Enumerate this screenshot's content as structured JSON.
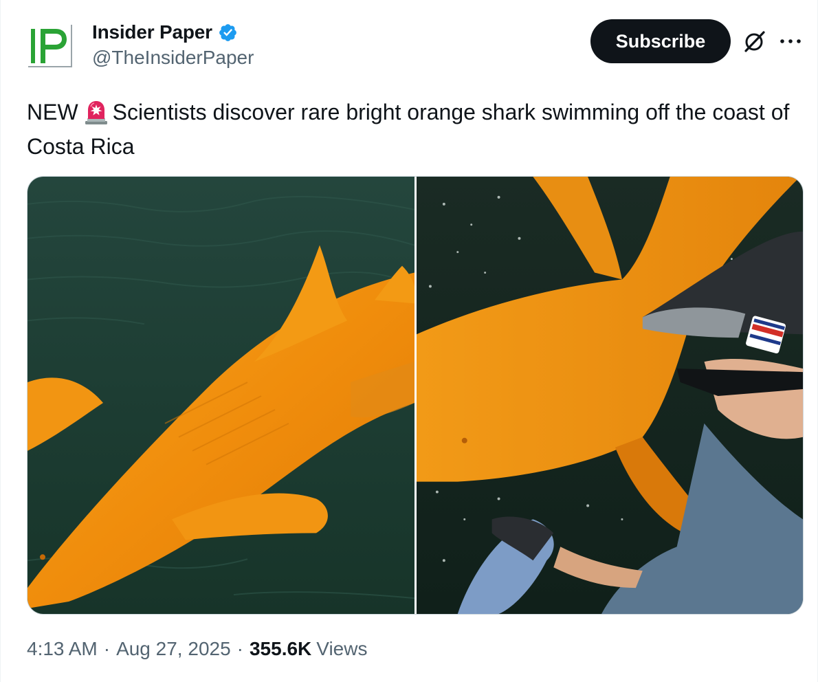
{
  "author": {
    "display_name": "Insider Paper",
    "handle": "@TheInsiderPaper",
    "verified": true,
    "avatar_text": "IP",
    "verified_color": "#1d9bf0"
  },
  "actions": {
    "subscribe_label": "Subscribe",
    "grok_icon": "grok-icon",
    "more_icon": "more-dots-icon"
  },
  "tweet": {
    "text_prefix": "NEW",
    "emoji": "police-siren-icon",
    "text_body": "Scientists discover rare bright orange shark swimming off the coast of Costa Rica"
  },
  "media": {
    "photos": [
      "orange-shark-photo-left",
      "orange-shark-photo-right"
    ]
  },
  "meta": {
    "time": "4:13 AM",
    "separator": "·",
    "date": "Aug 27, 2025",
    "views_count": "355.6K",
    "views_label": "Views"
  },
  "colors": {
    "text": "#0f1419",
    "secondary": "#536471",
    "accent": "#1d9bf0",
    "logo_green": "#2aa335"
  }
}
